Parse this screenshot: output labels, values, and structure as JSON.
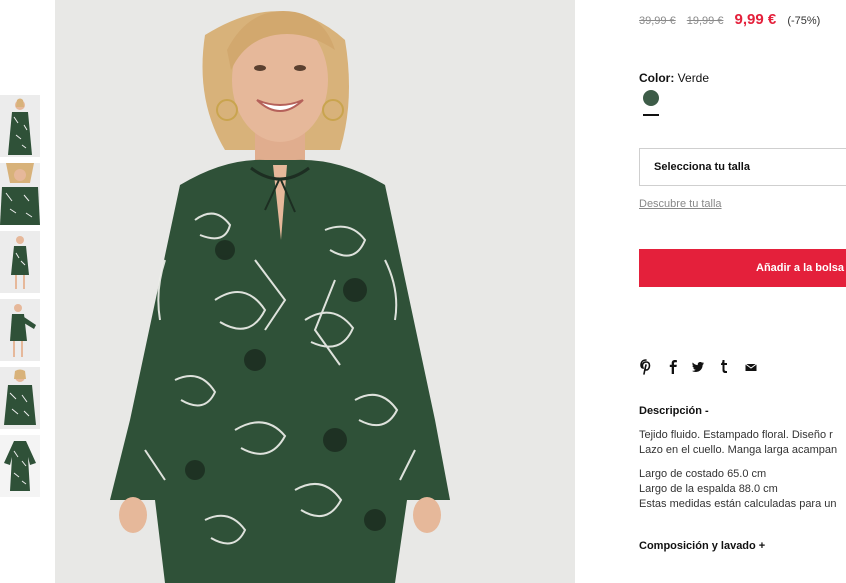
{
  "product": {
    "prices": {
      "original": "39,99 €",
      "previous": "19,99 €",
      "current": "9,99 €",
      "discount": "(-75%)"
    },
    "color": {
      "label": "Color:",
      "value": "Verde",
      "swatch_hex": "#3d5c48"
    },
    "size_select": {
      "value": "Selecciona tu talla"
    },
    "size_guide_link": "Descubre tu talla",
    "add_to_bag": "Añadir a la bolsa",
    "share_icons": [
      "pinterest-icon",
      "facebook-icon",
      "twitter-icon",
      "tumblr-icon",
      "mail-icon"
    ],
    "description": {
      "title": "Descripción -",
      "lines": [
        "Tejido fluido. Estampado floral. Diseño r",
        "Lazo en el cuello. Manga larga acampan",
        "Largo de costado 65.0 cm",
        "Largo de la espalda 88.0 cm",
        "Estas medidas están calculadas para un"
      ]
    },
    "composition": {
      "title": "Composición y lavado +"
    }
  },
  "gallery": {
    "thumbnails": [
      "front-view",
      "detail-view",
      "full-length-view",
      "side-view",
      "close-view",
      "flat-view"
    ],
    "colors": {
      "dress": "#2f5138",
      "print": "#f2f2ee",
      "background": "#e8e8e6",
      "skin": "#e6b89a",
      "hair": "#d8b27a"
    }
  }
}
